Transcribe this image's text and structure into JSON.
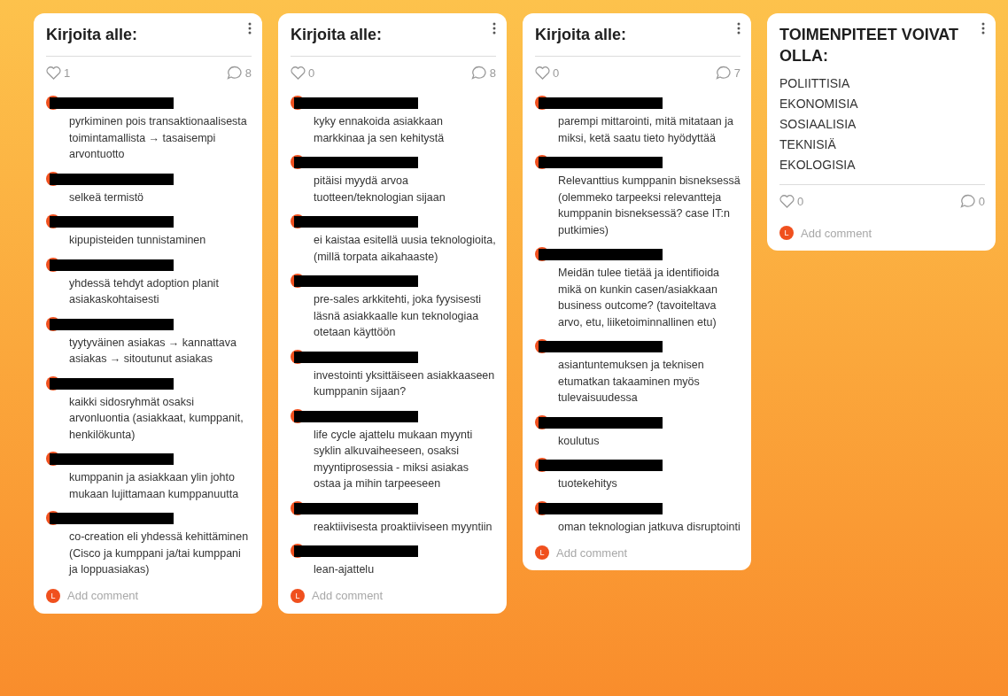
{
  "cards": [
    {
      "title": "Kirjoita alle:",
      "likes": "1",
      "comment_count": "8",
      "comments": [
        {
          "text": "pyrkiminen pois transaktionaalisesta toimintamallista → tasaisempi arvontuotto"
        },
        {
          "text": "selkeä termistö"
        },
        {
          "text": "kipupisteiden tunnistaminen"
        },
        {
          "text": "yhdessä tehdyt adoption planit asiakaskohtaisesti"
        },
        {
          "text": "tyytyväinen asiakas → kannattava asiakas → sitoutunut asiakas"
        },
        {
          "text": "kaikki sidosryhmät osaksi arvonluontia (asiakkaat, kumppanit, henkilökunta)"
        },
        {
          "text": "kumppanin ja asiakkaan ylin johto mukaan lujittamaan kumppanuutta"
        },
        {
          "text": "co-creation eli yhdessä kehittäminen (Cisco ja kumppani ja/tai kumppani ja loppuasiakas)"
        }
      ],
      "add_comment": {
        "avatar": "L",
        "placeholder": "Add comment"
      }
    },
    {
      "title": "Kirjoita alle:",
      "likes": "0",
      "comment_count": "8",
      "comments": [
        {
          "text": "kyky ennakoida asiakkaan markkinaa ja sen kehitystä"
        },
        {
          "text": "pitäisi myydä arvoa tuotteen/teknologian sijaan"
        },
        {
          "text": "ei kaistaa esitellä uusia teknologioita, (millä torpata aikahaaste)"
        },
        {
          "text": "pre-sales arkkitehti, joka fyysisesti läsnä asiakkaalle kun teknologiaa otetaan käyttöön"
        },
        {
          "text": "investointi yksittäiseen asiakkaaseen kumppanin sijaan?"
        },
        {
          "text": "life cycle ajattelu mukaan myynti syklin alkuvaiheeseen, osaksi myyntiprosessia - miksi asiakas ostaa ja mihin tarpeeseen"
        },
        {
          "text": "reaktiivisesta proaktiiviseen myyntiin"
        },
        {
          "text": "lean-ajattelu"
        }
      ],
      "add_comment": {
        "avatar": "L",
        "placeholder": "Add comment"
      }
    },
    {
      "title": "Kirjoita alle:",
      "likes": "0",
      "comment_count": "7",
      "comments": [
        {
          "text": "parempi mittarointi, mitä mitataan ja miksi, ketä saatu tieto hyödyttää"
        },
        {
          "text": "Relevanttius kumppanin bisneksessä (olemmeko tarpeeksi relevantteja kumppanin bisneksessä? case IT:n putkimies)"
        },
        {
          "text": "Meidän tulee tietää ja identifioida mikä on kunkin casen/asiakkaan business outcome? (tavoiteltava arvo, etu, liiketoiminnallinen etu)"
        },
        {
          "text": "asiantuntemuksen ja teknisen etumatkan takaaminen myös tulevaisuudessa"
        },
        {
          "text": "koulutus"
        },
        {
          "text": "tuotekehitys"
        },
        {
          "text": "oman teknologian jatkuva disruptointi"
        }
      ],
      "add_comment": {
        "avatar": "L",
        "placeholder": "Add comment"
      }
    },
    {
      "title": "TOIMENPITEET VOIVAT OLLA:",
      "body_lines": [
        "POLIITTISIA",
        "EKONOMISIA",
        "SOSIAALISIA",
        "TEKNISIÄ",
        "EKOLOGISIA"
      ],
      "likes": "0",
      "comment_count": "0",
      "add_comment": {
        "avatar": "L",
        "placeholder": "Add comment"
      }
    }
  ]
}
